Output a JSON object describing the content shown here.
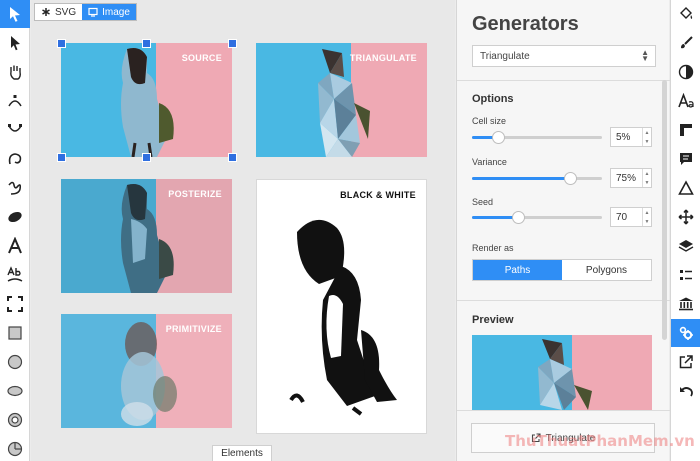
{
  "canvas": {
    "view_toggle": {
      "svg_label": "SVG",
      "image_label": "Image",
      "active": "Image"
    },
    "cards": [
      {
        "label": "SOURCE"
      },
      {
        "label": "TRIANGULATE"
      },
      {
        "label": "POSTERIZE"
      },
      {
        "label": "BLACK & WHITE"
      },
      {
        "label": "PRIMITIVIZE"
      }
    ],
    "elements_tab": "Elements"
  },
  "panel": {
    "title": "Generators",
    "generator_select": "Triangulate",
    "options_title": "Options",
    "cell_size": {
      "label": "Cell size",
      "value": "5%",
      "level": 0.2
    },
    "variance": {
      "label": "Variance",
      "value": "75%",
      "level": 0.75
    },
    "seed": {
      "label": "Seed",
      "value": "70",
      "level": 0.35
    },
    "render_as": {
      "label": "Render as",
      "options": [
        "Paths",
        "Polygons"
      ],
      "selected": "Paths"
    },
    "preview_title": "Preview",
    "generate_button": "Triangulate"
  },
  "watermark": "ThuThuatPhanMem.vn",
  "colors": {
    "accent": "#2f8ef5",
    "bg_blue": "#49b8e3",
    "bg_pink": "#efa9b4"
  }
}
